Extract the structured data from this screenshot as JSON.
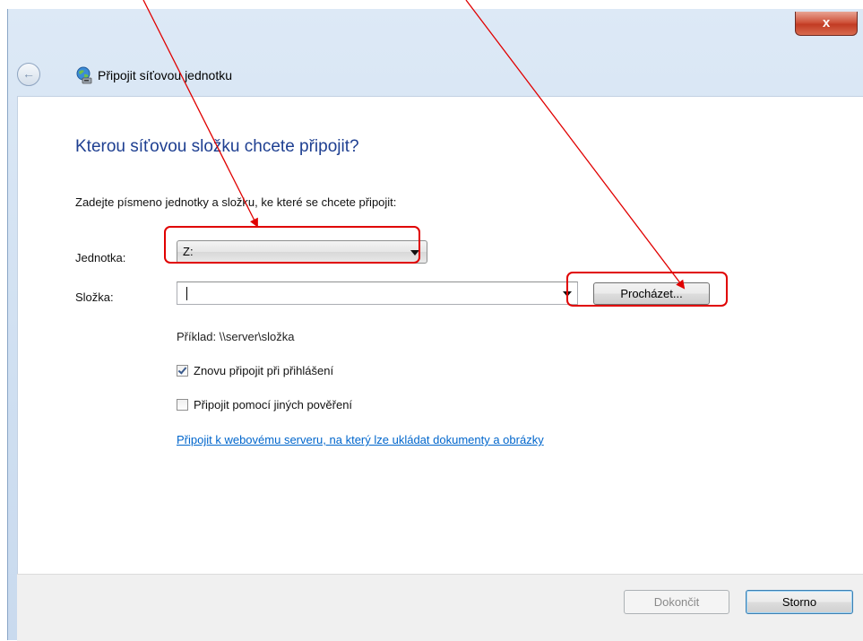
{
  "window": {
    "title": "Připojit síťovou jednotku",
    "close_label": "x"
  },
  "dialog": {
    "heading": "Kterou síťovou složku chcete připojit?",
    "instruction": "Zadejte písmeno jednotky a složku, ke které se chcete připojit:",
    "drive_label": "Jednotka:",
    "drive_value": "Z:",
    "folder_label": "Složka:",
    "folder_value": "",
    "browse_label": "Procházet...",
    "example_text": "Příklad: \\\\server\\složka",
    "reconnect_label": "Znovu připojit při přihlášení",
    "reconnect_checked": true,
    "other_credentials_label": "Připojit pomocí jiných pověření",
    "other_credentials_checked": false,
    "web_link": "Připojit k webovému serveru, na který lze ukládat dokumenty a obrázky"
  },
  "footer": {
    "finish_label": "Dokončit",
    "finish_enabled": false,
    "cancel_label": "Storno"
  },
  "icons": {
    "back": "back-arrow-icon",
    "network": "network-drive-icon",
    "dropdown": "chevron-down-icon"
  },
  "colors": {
    "heading": "#1e3f91",
    "link": "#0066cc",
    "annotation": "#e00000",
    "close_button": "#c23b23"
  }
}
